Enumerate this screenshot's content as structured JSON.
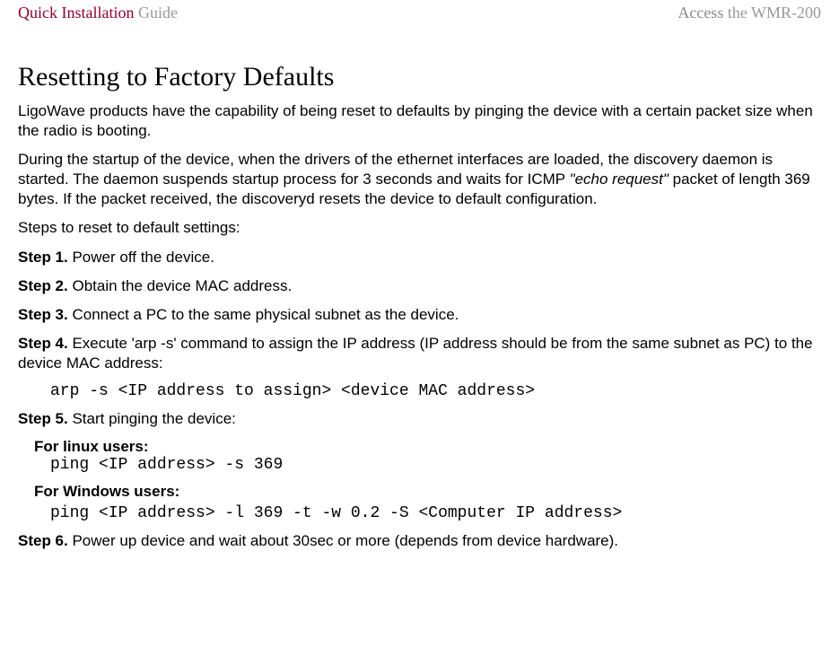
{
  "header": {
    "left_prefix": "Quick Installation",
    "left_suffix": " Guide",
    "right_prefix": "Access",
    "right_suffix": " the WMR-200"
  },
  "title": "Resetting to Factory Defaults",
  "intro_p1": "LigoWave products have the capability of being reset to defaults by pinging the device with a certain packet size when the radio is booting.",
  "intro_p2_a": "During the startup of the device, when the drivers of the ethernet interfaces are loaded, the discovery daemon is started. The daemon suspends startup process for 3 seconds and waits for ICMP ",
  "intro_p2_ital": "\"echo request\"",
  "intro_p2_b": " packet of length 369 bytes. If the packet received, the discoveryd resets the device to default configuration.",
  "steps_intro": "Steps to reset to default settings:",
  "step1_label": "Step 1.",
  "step1_text": " Power off the device.",
  "step2_label": "Step 2.",
  "step2_text": " Obtain the device MAC address.",
  "step3_label": "Step 3.",
  "step3_text": " Connect a PC to the same physical subnet as the device.",
  "step4_label": "Step 4.",
  "step4_text": " Execute 'arp -s' command to assign the IP address (IP address should be from the same subnet as PC) to the device MAC address:",
  "step4_code": "arp -s <IP address to assign> <device MAC address>",
  "step5_label": "Step 5.",
  "step5_text": " Start pinging the device:",
  "linux_label": "For linux users:",
  "linux_code": "ping <IP address> -s 369",
  "windows_label": "For Windows users:",
  "windows_code": "ping <IP address> -l 369 -t -w 0.2 -S <Computer IP address>",
  "step6_label": "Step 6.",
  "step6_text": " Power up device and wait about 30sec or more (depends from device hardware)."
}
